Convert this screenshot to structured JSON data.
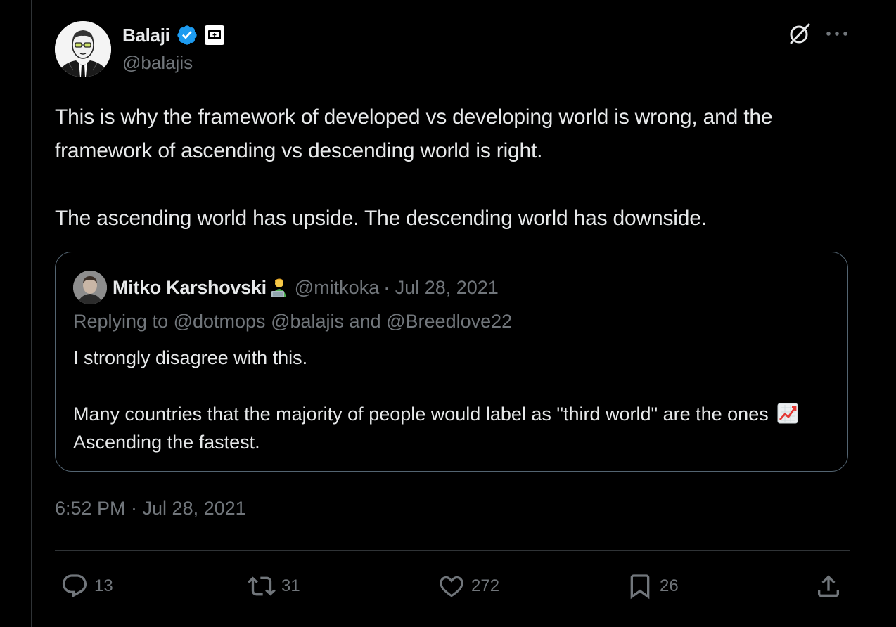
{
  "author": {
    "name": "Balaji",
    "handle": "@balajis"
  },
  "icons": {
    "verified": "verified-badge-icon",
    "affiliate": "affiliate-badge-icon",
    "grok": "grok-icon",
    "more": "more-options-icon",
    "reply": "reply-icon",
    "repost": "repost-icon",
    "like": "like-icon",
    "bookmark": "bookmark-icon",
    "share": "share-icon"
  },
  "colors": {
    "background": "#000000",
    "text": "#e7e9ea",
    "muted": "#71767b",
    "verified": "#1d9bf0",
    "border": "#2f3336"
  },
  "tweet": {
    "paragraph1": "This is why the framework of developed vs developing world is wrong, and the framework of ascending vs descending world is right.",
    "paragraph2": "The ascending world has upside. The descending world has downside.",
    "timestamp": "6:52 PM · Jul 28, 2021"
  },
  "quoted": {
    "name": "Mitko Karshovski",
    "handle": "@mitkoka",
    "date": "· Jul 28, 2021",
    "replying_prefix": "Replying to ",
    "mentions": [
      "@dotmops",
      "@balajis",
      "@Breedlove22"
    ],
    "and_word": "and",
    "paragraph1": "I strongly disagree with this.",
    "paragraph2_start": "Many countries that the majority of people would label as \"third world\" are the ones ",
    "paragraph2_end": "Ascending the fastest."
  },
  "actions": {
    "replies": "13",
    "reposts": "31",
    "likes": "272",
    "bookmarks": "26"
  }
}
